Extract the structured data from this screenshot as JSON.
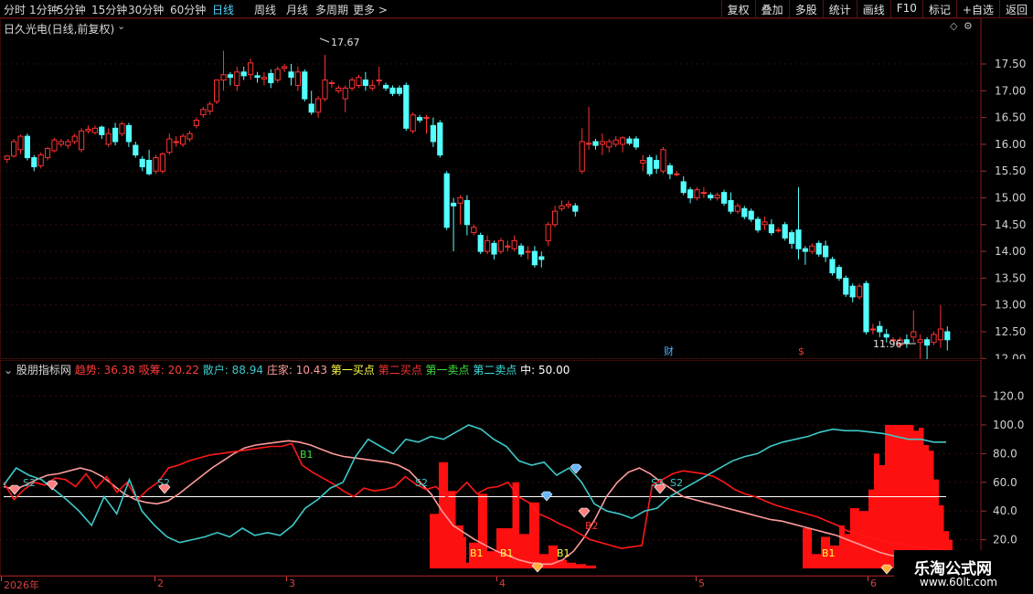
{
  "toolbar": {
    "periods": [
      "分时",
      "1分钟",
      "5分钟",
      "15分钟",
      "30分钟",
      "60分钟",
      "日线",
      "周线",
      "月线",
      "多周期",
      "更多 >"
    ],
    "active_period": "日线",
    "actions": [
      "复权",
      "叠加",
      "多股",
      "统计",
      "画线",
      "F10",
      "标记",
      "+自选",
      "返回"
    ]
  },
  "stock": {
    "title": "日久光电(日线,前复权)",
    "high_label": "17.67",
    "low_label": "11.96",
    "marker_cai": "财",
    "marker_dollar": "$"
  },
  "price_axis": [
    "17.50",
    "17.00",
    "16.50",
    "16.00",
    "15.50",
    "15.00",
    "14.50",
    "14.00",
    "13.50",
    "13.00",
    "12.50",
    "12.00"
  ],
  "indicator": {
    "name": "股朋指标网",
    "items": [
      {
        "label": "趋势: 36.38",
        "color": "#ff3b3b"
      },
      {
        "label": "吸筹: 20.22",
        "color": "#ff3b3b"
      },
      {
        "label": "散户: 88.94",
        "color": "#3ec8c8"
      },
      {
        "label": "庄家: 10.43",
        "color": "#ff9a9a"
      },
      {
        "label": "第一买点",
        "color": "#ffff40"
      },
      {
        "label": "第二买点",
        "color": "#ff3030"
      },
      {
        "label": "第一卖点",
        "color": "#40e040"
      },
      {
        "label": "第二卖点",
        "color": "#40e0e0"
      },
      {
        "label": "中: 50.00",
        "color": "#ffffff"
      }
    ],
    "axis": [
      "120.0",
      "100.0",
      "80.0",
      "60.0",
      "40.0",
      "20.0"
    ],
    "signals": [
      {
        "text": "S2",
        "color": "#3ec8c8"
      },
      {
        "text": "S2",
        "color": "#3ec8c8"
      },
      {
        "text": "B1",
        "color": "#40e040"
      },
      {
        "text": "S2",
        "color": "#3ec8c8"
      },
      {
        "text": "B1",
        "color": "#ffff40"
      },
      {
        "text": "B1",
        "color": "#ffff40"
      },
      {
        "text": "B1",
        "color": "#ffff40"
      },
      {
        "text": "B2",
        "color": "#ff3030"
      },
      {
        "text": "S2",
        "color": "#3ec8c8"
      },
      {
        "text": "S2",
        "color": "#3ec8c8"
      },
      {
        "text": "B1",
        "color": "#ffff40"
      }
    ]
  },
  "xaxis": {
    "labels": [
      "2026年",
      "2",
      "3",
      "4",
      "5",
      "6"
    ]
  },
  "watermark": {
    "title": "乐淘公式网",
    "url": "www.60lt.com"
  },
  "chart_data": {
    "type": "candlestick",
    "price_range": [
      11.8,
      17.9
    ],
    "candles": [
      [
        15.72,
        15.78,
        15.65,
        15.8
      ],
      [
        15.78,
        16.05,
        15.75,
        16.1
      ],
      [
        15.9,
        16.15,
        15.82,
        16.18
      ],
      [
        16.15,
        15.75,
        15.7,
        16.2
      ],
      [
        15.75,
        15.58,
        15.5,
        15.8
      ],
      [
        15.6,
        15.8,
        15.55,
        15.85
      ],
      [
        15.75,
        15.92,
        15.7,
        15.95
      ],
      [
        15.88,
        16.08,
        15.85,
        16.12
      ],
      [
        16.0,
        16.05,
        15.95,
        16.1
      ],
      [
        15.98,
        16.05,
        15.92,
        16.1
      ],
      [
        16.05,
        16.15,
        16.0,
        16.2
      ],
      [
        15.9,
        16.25,
        15.85,
        16.3
      ],
      [
        16.25,
        16.28,
        16.2,
        16.35
      ],
      [
        16.22,
        16.3,
        16.18,
        16.35
      ],
      [
        16.32,
        16.18,
        16.1,
        16.35
      ],
      [
        16.0,
        16.2,
        15.95,
        16.3
      ],
      [
        16.3,
        16.05,
        15.98,
        16.4
      ],
      [
        16.2,
        16.38,
        16.15,
        16.42
      ],
      [
        16.35,
        16.05,
        15.95,
        16.4
      ],
      [
        15.98,
        15.8,
        15.75,
        16.05
      ],
      [
        15.72,
        15.58,
        15.5,
        15.78
      ],
      [
        15.7,
        15.45,
        15.42,
        15.9
      ],
      [
        15.5,
        15.75,
        15.45,
        15.8
      ],
      [
        15.5,
        15.82,
        15.45,
        15.85
      ],
      [
        15.85,
        16.1,
        15.8,
        16.2
      ],
      [
        16.05,
        16.05,
        15.95,
        16.15
      ],
      [
        16.0,
        16.15,
        15.95,
        16.2
      ],
      [
        16.1,
        16.2,
        16.05,
        16.25
      ],
      [
        16.35,
        16.45,
        16.3,
        16.5
      ],
      [
        16.55,
        16.65,
        16.5,
        16.7
      ],
      [
        16.62,
        16.75,
        16.55,
        16.8
      ],
      [
        16.8,
        17.2,
        16.75,
        17.2
      ],
      [
        17.2,
        17.3,
        17.0,
        17.75
      ],
      [
        17.3,
        17.25,
        17.1,
        17.35
      ],
      [
        17.1,
        17.35,
        17.0,
        17.45
      ],
      [
        17.35,
        17.28,
        17.2,
        17.45
      ],
      [
        17.3,
        17.52,
        17.2,
        17.6
      ],
      [
        17.28,
        17.25,
        17.15,
        17.35
      ],
      [
        17.22,
        17.25,
        17.1,
        17.35
      ],
      [
        17.32,
        17.15,
        17.05,
        17.4
      ],
      [
        17.2,
        17.4,
        17.15,
        17.45
      ],
      [
        17.42,
        17.45,
        17.35,
        17.5
      ],
      [
        17.35,
        17.25,
        17.1,
        17.5
      ],
      [
        17.1,
        17.35,
        17.0,
        17.45
      ],
      [
        17.35,
        16.85,
        16.8,
        17.4
      ],
      [
        16.75,
        16.6,
        16.55,
        17.0
      ],
      [
        16.6,
        16.85,
        16.5,
        16.9
      ],
      [
        16.85,
        17.2,
        16.8,
        17.67
      ],
      [
        17.15,
        17.15,
        17.05,
        17.2
      ],
      [
        17.0,
        17.05,
        16.95,
        17.1
      ],
      [
        16.85,
        17.05,
        16.6,
        17.1
      ],
      [
        17.05,
        17.2,
        17.0,
        17.25
      ],
      [
        17.1,
        17.25,
        17.05,
        17.3
      ],
      [
        17.2,
        17.1,
        17.0,
        17.35
      ],
      [
        17.05,
        17.1,
        17.0,
        17.2
      ],
      [
        17.2,
        17.2,
        17.1,
        17.45
      ],
      [
        17.1,
        17.05,
        17.0,
        17.15
      ],
      [
        17.05,
        16.95,
        16.9,
        17.1
      ],
      [
        17.05,
        16.95,
        16.9,
        17.1
      ],
      [
        17.1,
        16.3,
        16.25,
        17.15
      ],
      [
        16.25,
        16.55,
        16.2,
        16.6
      ],
      [
        16.5,
        16.45,
        16.4,
        16.55
      ],
      [
        16.5,
        16.5,
        16.2,
        16.55
      ],
      [
        16.35,
        16.05,
        15.95,
        16.5
      ],
      [
        16.4,
        15.8,
        15.75,
        16.45
      ],
      [
        15.45,
        14.45,
        14.4,
        15.5
      ],
      [
        14.9,
        14.85,
        14.0,
        15.0
      ],
      [
        14.9,
        15.0,
        14.5,
        15.05
      ],
      [
        14.95,
        14.5,
        14.3,
        15.05
      ],
      [
        14.35,
        14.45,
        14.3,
        14.5
      ],
      [
        14.3,
        14.0,
        13.95,
        14.35
      ],
      [
        14.0,
        14.2,
        13.95,
        14.3
      ],
      [
        14.15,
        13.95,
        13.85,
        14.2
      ],
      [
        14.0,
        14.2,
        13.95,
        14.25
      ],
      [
        14.1,
        14.1,
        14.0,
        14.2
      ],
      [
        14.05,
        14.2,
        14.0,
        14.3
      ],
      [
        14.1,
        13.95,
        13.9,
        14.15
      ],
      [
        14.0,
        14.0,
        13.85,
        14.1
      ],
      [
        14.0,
        13.75,
        13.7,
        14.1
      ],
      [
        13.9,
        13.85,
        13.7,
        14.0
      ],
      [
        14.2,
        14.5,
        14.1,
        14.55
      ],
      [
        14.5,
        14.75,
        14.45,
        14.85
      ],
      [
        14.8,
        14.85,
        14.75,
        14.95
      ],
      [
        14.85,
        14.88,
        14.8,
        14.95
      ],
      [
        14.85,
        14.75,
        14.65,
        14.9
      ],
      [
        15.5,
        16.05,
        15.45,
        16.3
      ],
      [
        16.0,
        16.02,
        15.9,
        16.7
      ],
      [
        16.05,
        15.98,
        15.9,
        16.1
      ],
      [
        16.0,
        16.05,
        15.8,
        16.2
      ],
      [
        15.95,
        16.05,
        15.85,
        16.1
      ],
      [
        16.0,
        16.08,
        15.95,
        16.15
      ],
      [
        16.0,
        16.12,
        15.85,
        16.15
      ],
      [
        16.1,
        16.02,
        15.98,
        16.15
      ],
      [
        16.1,
        15.95,
        15.9,
        16.15
      ],
      [
        15.65,
        15.7,
        15.5,
        15.8
      ],
      [
        15.75,
        15.45,
        15.4,
        15.8
      ],
      [
        15.7,
        15.55,
        15.45,
        15.8
      ],
      [
        15.5,
        15.9,
        15.45,
        15.95
      ],
      [
        15.6,
        15.45,
        15.35,
        15.65
      ],
      [
        15.45,
        15.45,
        15.4,
        15.5
      ],
      [
        15.3,
        15.1,
        15.05,
        15.4
      ],
      [
        15.15,
        15.0,
        14.9,
        15.2
      ],
      [
        15.0,
        15.15,
        14.95,
        15.2
      ],
      [
        15.1,
        15.1,
        15.0,
        15.2
      ],
      [
        15.05,
        15.0,
        14.95,
        15.1
      ],
      [
        15.0,
        15.05,
        14.95,
        15.1
      ],
      [
        15.1,
        14.9,
        14.85,
        15.15
      ],
      [
        14.95,
        14.75,
        14.7,
        15.1
      ],
      [
        14.75,
        14.85,
        14.7,
        14.9
      ],
      [
        14.8,
        14.65,
        14.6,
        14.85
      ],
      [
        14.75,
        14.6,
        14.55,
        14.8
      ],
      [
        14.6,
        14.4,
        14.35,
        14.65
      ],
      [
        14.5,
        14.55,
        14.4,
        14.65
      ],
      [
        14.5,
        14.35,
        14.3,
        14.6
      ],
      [
        14.4,
        14.4,
        14.35,
        14.45
      ],
      [
        14.5,
        14.25,
        14.2,
        14.55
      ],
      [
        14.35,
        14.15,
        14.05,
        14.4
      ],
      [
        14.4,
        14.05,
        13.85,
        15.2
      ],
      [
        14.05,
        14.0,
        13.75,
        14.1
      ],
      [
        14.0,
        14.1,
        13.95,
        14.15
      ],
      [
        14.15,
        13.95,
        13.9,
        14.2
      ],
      [
        14.1,
        13.9,
        13.8,
        14.2
      ],
      [
        13.85,
        13.6,
        13.55,
        13.9
      ],
      [
        13.7,
        13.5,
        13.45,
        13.75
      ],
      [
        13.5,
        13.2,
        13.15,
        13.55
      ],
      [
        13.35,
        13.15,
        13.05,
        13.4
      ],
      [
        13.15,
        13.35,
        13.1,
        13.4
      ],
      [
        13.4,
        12.5,
        12.45,
        13.45
      ],
      [
        12.55,
        12.55,
        12.45,
        12.65
      ],
      [
        12.6,
        12.5,
        12.4,
        12.7
      ],
      [
        12.45,
        12.4,
        12.3,
        12.55
      ],
      [
        12.35,
        12.35,
        12.3,
        12.4
      ],
      [
        12.25,
        12.35,
        12.2,
        12.4
      ],
      [
        12.35,
        12.28,
        12.2,
        12.45
      ],
      [
        12.4,
        12.5,
        12.3,
        12.9
      ],
      [
        12.3,
        12.35,
        12.0,
        12.45
      ],
      [
        12.35,
        12.25,
        11.96,
        12.4
      ],
      [
        12.3,
        12.45,
        12.25,
        12.5
      ],
      [
        12.35,
        12.55,
        12.2,
        13.0
      ],
      [
        12.5,
        12.35,
        12.15,
        12.6
      ]
    ],
    "indicator_series": {
      "trend_red": [
        60,
        48,
        55,
        60,
        58,
        63,
        62,
        57,
        66,
        56,
        64,
        53,
        60,
        48,
        55,
        60,
        70,
        72,
        75,
        77,
        79,
        80,
        81,
        82,
        83,
        84,
        85,
        85,
        87,
        72,
        67,
        63,
        59,
        54,
        50,
        56,
        54,
        55,
        57,
        64,
        59,
        55,
        57,
        50,
        53,
        60,
        52,
        56,
        57,
        60,
        50,
        46,
        38,
        35,
        31,
        28,
        24,
        20,
        18,
        16,
        14,
        15,
        16,
        58,
        62,
        66,
        68,
        67,
        66,
        64,
        60,
        55,
        52,
        50,
        47,
        44,
        42,
        40,
        38,
        36,
        33,
        30,
        26,
        24,
        22,
        20,
        18,
        17,
        16,
        15,
        14,
        13,
        12
      ],
      "zhuangjia_pink": [
        57,
        55,
        58,
        62,
        65,
        66,
        68,
        70,
        68,
        64,
        58,
        52,
        48,
        46,
        45,
        47,
        52,
        58,
        64,
        70,
        75,
        80,
        84,
        86,
        87,
        88,
        89,
        88,
        86,
        83,
        80,
        78,
        77,
        76,
        75,
        74,
        72,
        68,
        60,
        52,
        40,
        30,
        25,
        20,
        16,
        12,
        9,
        6,
        4,
        3,
        3,
        6,
        12,
        22,
        35,
        50,
        60,
        67,
        70,
        66,
        60,
        55,
        50,
        48,
        46,
        44,
        42,
        40,
        38,
        36,
        34,
        33,
        31,
        29,
        27,
        25,
        23,
        20,
        17,
        14,
        11,
        9,
        8,
        7,
        6,
        5,
        4
      ],
      "sanhu_teal": [
        58,
        70,
        65,
        62,
        55,
        48,
        40,
        30,
        50,
        38,
        62,
        40,
        30,
        22,
        18,
        20,
        22,
        25,
        22,
        28,
        23,
        25,
        23,
        30,
        42,
        48,
        56,
        60,
        78,
        90,
        85,
        80,
        90,
        88,
        92,
        90,
        95,
        100,
        97,
        90,
        85,
        75,
        72,
        74,
        65,
        70,
        60,
        45,
        40,
        38,
        35,
        40,
        42,
        50,
        55,
        60,
        65,
        70,
        75,
        78,
        80,
        85,
        88,
        90,
        92,
        95,
        97,
        96,
        96,
        95,
        94,
        92,
        90,
        90,
        88,
        88
      ]
    },
    "bars_red": [
      [
        470,
        490,
        38,
        74
      ],
      [
        490,
        507,
        54,
        30
      ],
      [
        507,
        513,
        22,
        4
      ],
      [
        513,
        533,
        18,
        52
      ],
      [
        533,
        553,
        12,
        28
      ],
      [
        553,
        568,
        28,
        60
      ],
      [
        568,
        590,
        24,
        46
      ],
      [
        590,
        610,
        10,
        16
      ],
      [
        610,
        630,
        6,
        4
      ],
      [
        630,
        652,
        3,
        2
      ],
      [
        878,
        898,
        28,
        10
      ],
      [
        898,
        918,
        22,
        16
      ],
      [
        918,
        930,
        30,
        24
      ],
      [
        930,
        950,
        42,
        40
      ],
      [
        950,
        962,
        55,
        80
      ],
      [
        962,
        974,
        72,
        100
      ],
      [
        974,
        994,
        100,
        100
      ],
      [
        994,
        1005,
        100,
        96
      ],
      [
        1005,
        1016,
        98,
        86
      ],
      [
        1016,
        1027,
        82,
        62
      ],
      [
        1027,
        1038,
        44,
        26
      ],
      [
        1038,
        1046,
        20,
        4
      ]
    ],
    "midline": 50
  }
}
